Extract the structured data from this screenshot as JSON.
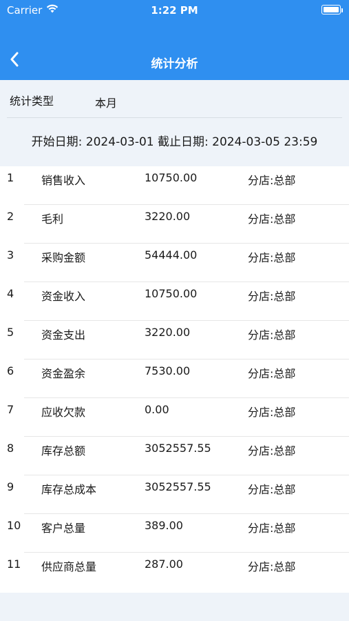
{
  "status": {
    "carrier": "Carrier",
    "time": "1:22 PM"
  },
  "nav": {
    "title": "统计分析"
  },
  "filter": {
    "type_label": "统计类型",
    "type_value": "本月"
  },
  "date_range": "开始日期: 2024-03-01  截止日期: 2024-03-05 23:59",
  "rows": [
    {
      "index": "1",
      "name": "销售收入",
      "value": "10750.00",
      "store": "分店:总部"
    },
    {
      "index": "2",
      "name": "毛利",
      "value": "3220.00",
      "store": "分店:总部"
    },
    {
      "index": "3",
      "name": "采购金额",
      "value": "54444.00",
      "store": "分店:总部"
    },
    {
      "index": "4",
      "name": "资金收入",
      "value": "10750.00",
      "store": "分店:总部"
    },
    {
      "index": "5",
      "name": "资金支出",
      "value": "3220.00",
      "store": "分店:总部"
    },
    {
      "index": "6",
      "name": "资金盈余",
      "value": "7530.00",
      "store": "分店:总部"
    },
    {
      "index": "7",
      "name": "应收欠款",
      "value": "0.00",
      "store": "分店:总部"
    },
    {
      "index": "8",
      "name": "库存总额",
      "value": "3052557.55",
      "store": "分店:总部"
    },
    {
      "index": "9",
      "name": "库存总成本",
      "value": "3052557.55",
      "store": "分店:总部"
    },
    {
      "index": "10",
      "name": "客户总量",
      "value": "389.00",
      "store": "分店:总部"
    },
    {
      "index": "11",
      "name": "供应商总量",
      "value": "287.00",
      "store": "分店:总部"
    }
  ],
  "colors": {
    "header": "#2f8ff0",
    "background": "#eef3f9",
    "table": "#ffffff"
  },
  "icons": {
    "wifi": "wifi-icon",
    "battery": "battery-icon",
    "back": "chevron-left-icon"
  }
}
